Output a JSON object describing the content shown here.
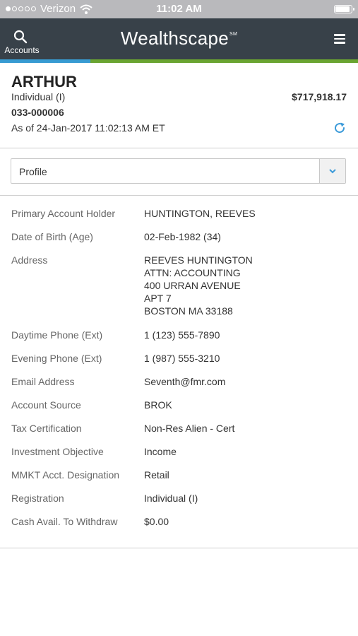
{
  "status_bar": {
    "carrier": "Verizon",
    "time": "11:02 AM",
    "signal_bars_filled": 1,
    "signal_bars_total": 5,
    "battery_level": 0.9
  },
  "nav": {
    "accounts_label": "Accounts",
    "brand": "Wealthscape",
    "brand_mark": "SM"
  },
  "account": {
    "name": "ARTHUR",
    "type": "Individual (I)",
    "balance": "$717,918.17",
    "number": "033-000006",
    "as_of": "As of 24-Jan-2017 11:02:13 AM ET"
  },
  "view_select": {
    "selected": "Profile"
  },
  "details": {
    "primary_account_holder": {
      "label": "Primary Account Holder",
      "value": "HUNTINGTON, REEVES"
    },
    "date_of_birth": {
      "label": "Date of Birth (Age)",
      "value": "02-Feb-1982 (34)"
    },
    "address": {
      "label": "Address",
      "lines": [
        "REEVES HUNTINGTON",
        "ATTN: ACCOUNTING",
        "400 URRAN AVENUE",
        "APT 7",
        "BOSTON MA 33188"
      ]
    },
    "daytime_phone": {
      "label": "Daytime Phone (Ext)",
      "value": "1 (123) 555-7890"
    },
    "evening_phone": {
      "label": "Evening Phone (Ext)",
      "value": "1 (987) 555-3210"
    },
    "email": {
      "label": "Email Address",
      "value": "Seventh@fmr.com"
    },
    "account_source": {
      "label": "Account Source",
      "value": "BROK"
    },
    "tax_certification": {
      "label": "Tax Certification",
      "value": "Non-Res Alien - Cert"
    },
    "investment_objective": {
      "label": "Investment Objective",
      "value": "Income"
    },
    "mmkt_designation": {
      "label": "MMKT Acct. Designation",
      "value": "Retail"
    },
    "registration": {
      "label": "Registration",
      "value": "Individual (I)"
    },
    "cash_available": {
      "label": "Cash Avail. To Withdraw",
      "value": "$0.00"
    }
  },
  "colors": {
    "nav_bg": "#384149",
    "accent_blue": "#389bd2",
    "accent_green": "#6aa431",
    "refresh_icon": "#3a9ad9"
  }
}
